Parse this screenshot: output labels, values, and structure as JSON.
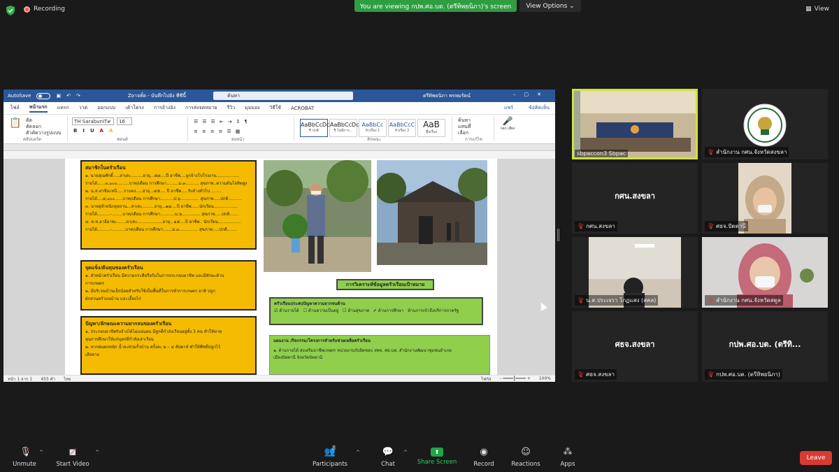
{
  "top": {
    "recording_label": "Recording",
    "viewing_banner": "You are viewing กปพ.ศอ.บต. (ตรีทิพยนิภา)'s screen",
    "view_options": "View Options",
    "view_label": "View"
  },
  "word": {
    "autosave_label": "AutoSave",
    "doc_title": "Zoาจทั๋ด - บันทึกไปยัง พีซีนี้",
    "search_placeholder": "ค้นหา",
    "user_name": "ตรีทิพยนิภา พรหมรัตน์",
    "tabs": [
      "ไฟล์",
      "หน้าแรก",
      "แทรก",
      "วาด",
      "ออกแบบ",
      "เค้าโครง",
      "การอ้างอิง",
      "การส่งจดหมาย",
      "รีวิว",
      "มุมมอง",
      "วิธีใช้",
      "ACROBAT"
    ],
    "share_label": "แชร์",
    "comments_label": "ข้อคิดเห็น",
    "font_name": "TH SarabunIT๙",
    "font_size": "16",
    "groups": {
      "clipboard": "คลิปบอร์ด",
      "font": "ฟอนต์",
      "paragraph": "ย่อหน้า",
      "styles": "ลักษณะ",
      "editing": "การแก้ไข",
      "voice": "เสียง"
    },
    "clipboard_items": [
      "ตัด",
      "คัดลอก",
      "ตัวคัดวางรูปแบบ"
    ],
    "styles": [
      {
        "preview": "AaBbCcDc",
        "name": "¶ ปกติ"
      },
      {
        "preview": "AaBbCcDc",
        "name": "¶ ไม่มีการ..."
      },
      {
        "preview": "AaBbCc",
        "name": "หัวเรื่อง 1"
      },
      {
        "preview": "AaBbCcC",
        "name": "หัวเรื่อง 2"
      },
      {
        "preview": "AaB",
        "name": "ชื่อเรื่อง"
      }
    ],
    "editing_items": [
      "ค้นหา",
      "แทนที่",
      "เลือก"
    ],
    "dictate_label": "กอก เสียง",
    "status": {
      "page": "หน้า 1 จาก 1",
      "words": "455 คำ",
      "lang": "ไทย",
      "focus": "โฟกัส",
      "zoom": "100%"
    }
  },
  "document": {
    "box1_title": "สมาชิกในครัวเรือน",
    "box1_lines": [
      "๑. นายสุเมศักดิ์.....ลาเสะ.........อายุ...๕๘....ปี อาชีพ....ลูกจ้างโบโรงงาน.................",
      "รายได้......๓,๐๐๐.........บาท/เดือน การศึกษา.........ม.๓.......... สุขภาพ..ความดันโลหิตสูง",
      "๒. น.ส.ฮาซีอะหนี.....ราแดง.....อายุ...๔๕.... ปี อาชีพ.....รับจ้างทั่วไป.........",
      "รายได้....๔,๐๐๐......บาท/เดือน การศึกษา..........ป.๖.............. สุขภาพ.....ปกติ..........",
      "๓. นายสุลำหนิกสุลถาน...ลาเสะ.........อายุ...๑๘....ปี อาชีพ......นักเรียน..................",
      "รายได้..........-........บาท/เดือน การศึกษา...........ม.๖.............. สุขภาพ.....ปกติ.......",
      "๔. ด.ช.อาอีอาซะ.......ลาเสะ...................อายุ...๑๕....ปี อาชีพ.. นักเรียน.................",
      "รายได้..........-..........บาท/เดือน การศึกษา.......ม.๓.............. สุขภาพ.....ปกติ......."
    ],
    "box2_title": "จุดแข็ง/ต้นทุนของครัวเรือน",
    "box2_lines": [
      "๑. หัวหน้าครัวเรือน มีความกระตือรือร้นในการประกอบอาชีพ และมีทักษะด้าน",
      "การเกษตร",
      "๒. มีบริเวณบ้านเล็กน้อยสำหรับใช้เป็นพื้นที่ในการทำการเกษตร อาทิ ปลูก",
      "ผักสวนครัวบนบ้าน และเลี้ยงไก่"
    ],
    "box3_title": "ปัญหา/ลักษณะความยากจนของครัวเรือน",
    "box3_lines": [
      "๑. ประกอบอาชีพรับจ้างได้ไม่แน่นอน มีลูกที่กำลังเรียนอยู่ทั้ง 3 คน ทำให้ขาด",
      "ทุนการศึกษาให้แก่บุตรที่กำลังเล่าเรียน",
      "๒. หากฝนตกหนัก น้ำจะท่วมรั้วบ้าน ครั้งละ ๒ – ๔ สัปดาห์ ทำให้พืชที่ปลูกไว้",
      "เสียหาย"
    ],
    "analysis_title": "การวิเคราะห์ข้อมูลครัวเรือนเป้าหมาย",
    "problem_title": "ครัวเรือนประสบปัญหาความยากจนด้าน",
    "problem_checks": [
      {
        "label": "ด้านรายได้",
        "checked": true
      },
      {
        "label": "ด้านความเป็นอยู่",
        "checked": false
      },
      {
        "label": "ด้านสุขภาพ",
        "checked": false
      },
      {
        "label": "ด้านการศึกษา",
        "checked": true
      },
      {
        "label": "ด้านการเข้าถึงบริการภาครัฐ",
        "checked": false
      }
    ],
    "plan_title": "แผนงาน /กิจกรรม/โครงการสำหรับช่วยเหลือครัวเรือน",
    "plan_lines": [
      "๑. ด้านรายได้ ส่งเสริมอาชีพเกษตร หน่วยงานรับผิดชอบ สพจ. ศอ.บต. สำนักงานพัฒนาชุมชนอำเภอ",
      "เมืองปัตตานี จังหวัดปัตตานี"
    ]
  },
  "gallery": [
    {
      "name": "sbpaccon3 Sbpac",
      "muted": false,
      "type": "video",
      "active": true
    },
    {
      "name": "สำนักงาน กศน.จังหวัดสงขลา",
      "muted": true,
      "type": "logo"
    },
    {
      "name": "กศน.สงขลา",
      "muted": true,
      "type": "text",
      "big": "กศน.สงขลา"
    },
    {
      "name": "ศธจ.ปัตตานี",
      "muted": true,
      "type": "person"
    },
    {
      "name": "น.ส.ประเจรา โกฏแสง (สคล)",
      "muted": true,
      "type": "room"
    },
    {
      "name": "สำนักงาน กศน.จังหวัดสตูล",
      "muted": true,
      "type": "person2"
    },
    {
      "name": "ศธจ.สงขลา",
      "muted": true,
      "type": "text",
      "big": "ศธจ.สงขลา"
    },
    {
      "name": "กปพ.ศอ.บต. (ตรีทิพยนิภา)",
      "muted": true,
      "type": "text",
      "big": "กปพ.ศอ.บต. (ตรีทิ..."
    }
  ],
  "toolbar": {
    "unmute": "Unmute",
    "start_video": "Start Video",
    "participants": "Participants",
    "participants_count": "8",
    "chat": "Chat",
    "share_screen": "Share Screen",
    "record": "Record",
    "reactions": "Reactions",
    "apps": "Apps",
    "leave": "Leave"
  }
}
